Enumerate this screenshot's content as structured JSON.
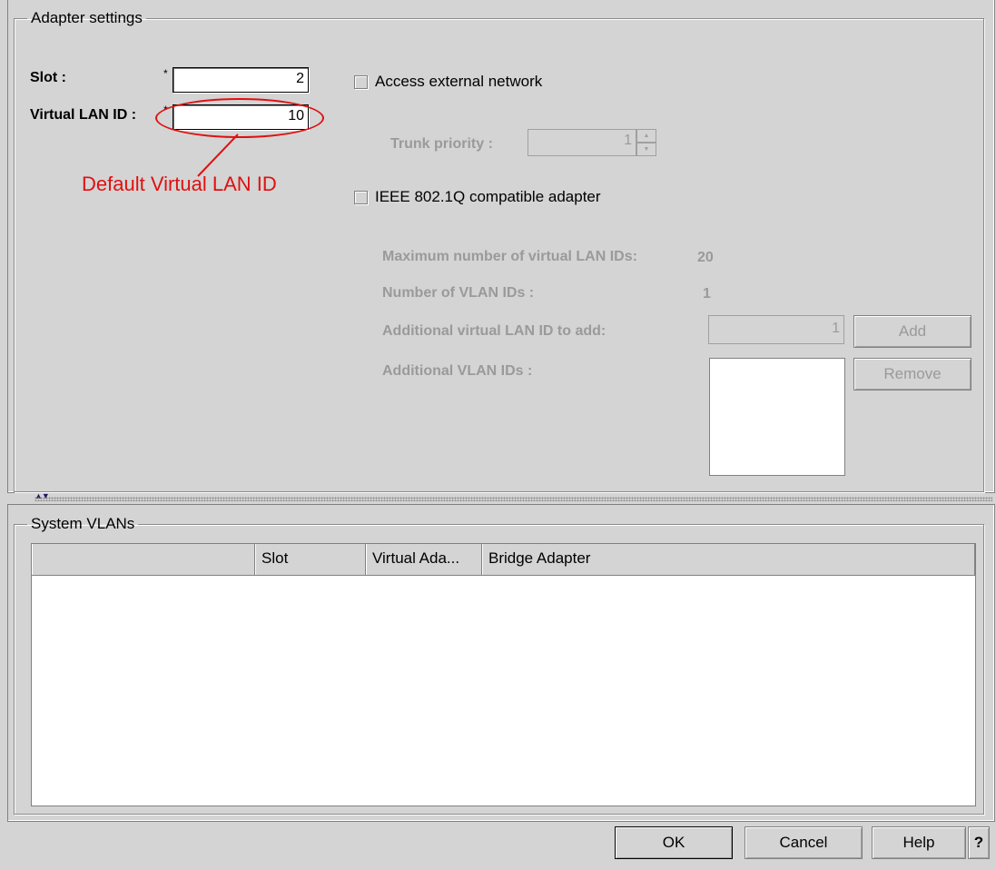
{
  "adapter_settings": {
    "group_title": "Adapter settings",
    "slot_label": "Slot :",
    "slot_value": "2",
    "vlan_id_label": "Virtual LAN ID :",
    "vlan_id_value": "10",
    "required_marker": "*",
    "access_external_label": "Access external network",
    "trunk_priority_label": "Trunk priority :",
    "trunk_priority_value": "1",
    "ieee_label": "IEEE 802.1Q compatible adapter",
    "max_vlan_label": "Maximum number of virtual LAN IDs:",
    "max_vlan_value": "20",
    "num_vlan_label": "Number of VLAN IDs :",
    "num_vlan_value": "1",
    "additional_to_add_label": "Additional virtual LAN ID to add:",
    "additional_to_add_value": "1",
    "additional_vlan_ids_label": "Additional VLAN IDs :",
    "add_button": "Add",
    "remove_button": "Remove"
  },
  "annotation": {
    "text": "Default Virtual LAN ID",
    "color": "#e01010"
  },
  "system_vlans": {
    "group_title": "System VLANs",
    "columns": [
      "",
      "Slot",
      "Virtual Ada...",
      "Bridge Adapter"
    ],
    "rows": []
  },
  "footer": {
    "ok": "OK",
    "cancel": "Cancel",
    "help": "Help",
    "question": "?"
  },
  "colors": {
    "background": "#d4d4d4",
    "disabled_text": "#9a9a9a",
    "annotation": "#e01010"
  }
}
